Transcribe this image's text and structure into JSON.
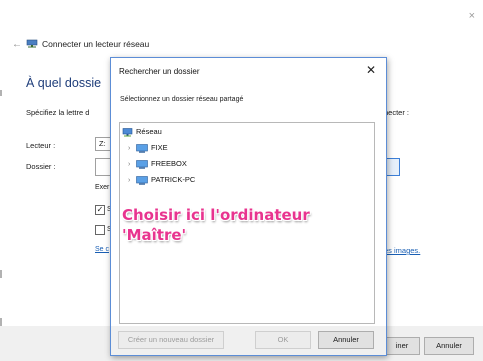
{
  "wizard": {
    "title": "Connecter un lecteur réseau",
    "heading": "À quel dossie",
    "specify_text": "Spécifiez la lettre d",
    "specify_text_end": "necter :",
    "drive_label": "Lecteur :",
    "drive_value": "Z:",
    "folder_label": "Dossier :",
    "browse_partial": "..",
    "example_partial": "Exer",
    "option1_partial": "S",
    "option2_partial": "S",
    "link_partial": "Se c",
    "link_end": "es images.",
    "finish_partial": "iner",
    "cancel_label": "Annuler",
    "close_glyph": "×",
    "back_glyph": "←"
  },
  "dialog": {
    "title": "Rechercher un dossier",
    "close_glyph": "✕",
    "subtitle": "Sélectionnez un dossier réseau partagé",
    "tree": [
      {
        "label": "Réseau",
        "level": 0,
        "expandable": false
      },
      {
        "label": "FIXE",
        "level": 1,
        "expandable": true
      },
      {
        "label": "FREEBOX",
        "level": 1,
        "expandable": true
      },
      {
        "label": "PATRICK-PC",
        "level": 1,
        "expandable": true
      }
    ],
    "new_folder_label": "Créer un nouveau dossier",
    "ok_label": "OK",
    "cancel_label": "Annuler"
  },
  "annotation": {
    "line1": "Choisir ici l'ordinateur",
    "line2": "'Maître'",
    "color": "#e8348f"
  },
  "icons": {
    "network": "network-icon",
    "computer": "computer-icon",
    "chevron": "chevron-right-icon"
  }
}
